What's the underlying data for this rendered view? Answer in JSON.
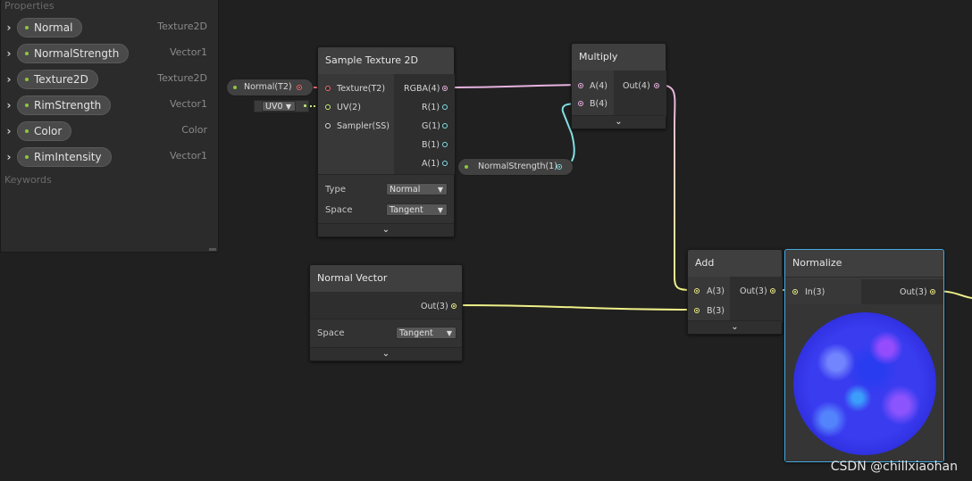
{
  "blackboard": {
    "header": "Properties",
    "keywords_label": "Keywords",
    "properties": [
      {
        "name": "Normal",
        "type": "Texture2D"
      },
      {
        "name": "NormalStrength",
        "type": "Vector1"
      },
      {
        "name": "Texture2D",
        "type": "Texture2D"
      },
      {
        "name": "RimStrength",
        "type": "Vector1"
      },
      {
        "name": "Color",
        "type": "Color"
      },
      {
        "name": "RimIntensity",
        "type": "Vector1"
      }
    ]
  },
  "nodes": {
    "sample_texture": {
      "title": "Sample Texture 2D",
      "inputs": [
        "Texture(T2)",
        "UV(2)",
        "Sampler(SS)"
      ],
      "outputs": [
        "RGBA(4)",
        "R(1)",
        "G(1)",
        "B(1)",
        "A(1)"
      ],
      "type_label": "Type",
      "type_value": "Normal",
      "space_label": "Space",
      "space_value": "Tangent",
      "expander": "⌄"
    },
    "multiply": {
      "title": "Multiply",
      "inputs": [
        "A(4)",
        "B(4)"
      ],
      "output": "Out(4)",
      "expander": "⌄"
    },
    "normal_vector": {
      "title": "Normal Vector",
      "output": "Out(3)",
      "space_label": "Space",
      "space_value": "Tangent",
      "expander": "⌄"
    },
    "add": {
      "title": "Add",
      "inputs": [
        "A(3)",
        "B(3)"
      ],
      "output": "Out(3)",
      "expander": "⌄"
    },
    "normalize": {
      "title": "Normalize",
      "input": "In(3)",
      "output": "Out(3)"
    }
  },
  "property_nodes": {
    "normal": "Normal(T2)",
    "uv": "UV0",
    "normal_strength": "NormalStrength(1)"
  },
  "watermark": "CSDN @chillxiaohan",
  "colors": {
    "vector4": "#e8b4e0",
    "texture": "#ee6b6b",
    "vector2": "#c7f07b",
    "vector1": "#84e0e6",
    "vector3": "#f0f08a",
    "selected": "#44a8e0"
  }
}
